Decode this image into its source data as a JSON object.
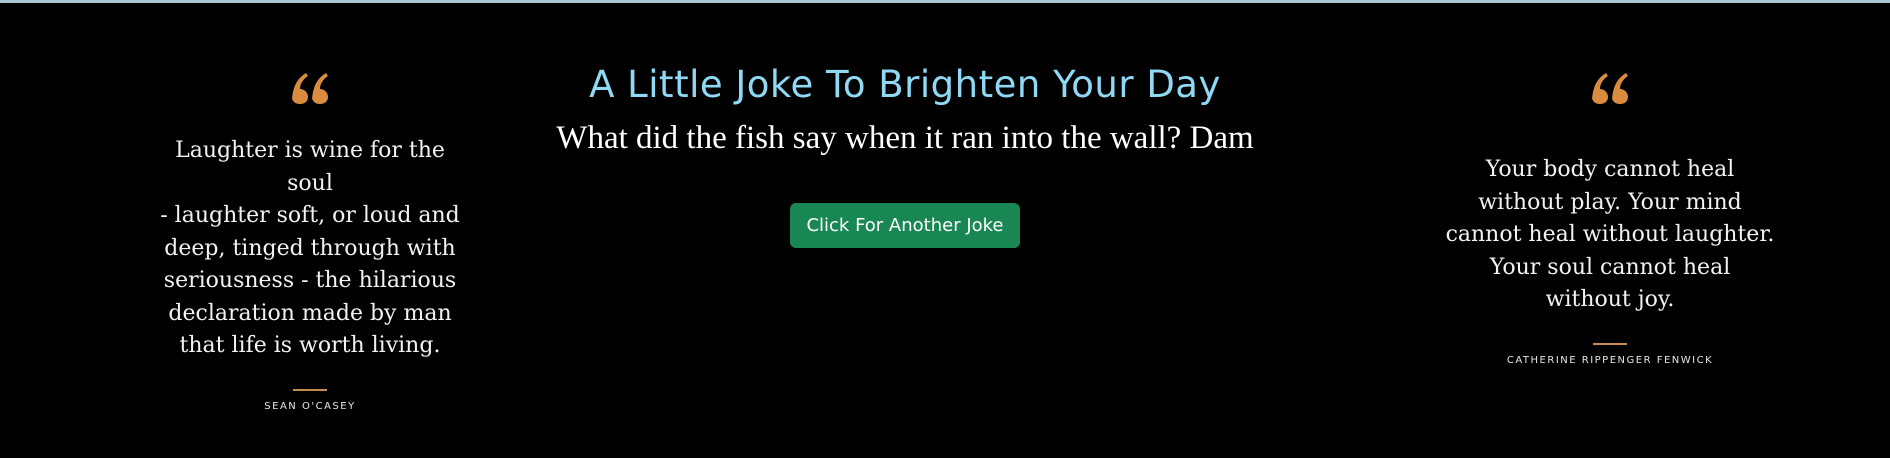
{
  "page": {
    "title": "A Little Joke To Brighten Your Day",
    "joke": "What did the fish say when it ran into the wall? Dam",
    "button_label": "Click For Another Joke"
  },
  "quotes": {
    "left": {
      "lines": [
        "Laughter is wine for the soul",
        "- laughter soft, or loud and",
        "deep, tinged through with",
        "seriousness - the hilarious",
        "declaration made by man",
        "that life is worth living."
      ],
      "author": "SEAN O'CASEY"
    },
    "right": {
      "lines": [
        "Your body cannot heal",
        "without play. Your mind",
        "cannot heal without laughter.",
        "Your soul cannot heal",
        "without joy."
      ],
      "author": "CATHERINE RIPPENGER FENWICK"
    }
  },
  "colors": {
    "accent_gold": "#d98c3f",
    "title_blue": "#8fd9f5",
    "button_green": "#198754",
    "background": "#000000"
  }
}
